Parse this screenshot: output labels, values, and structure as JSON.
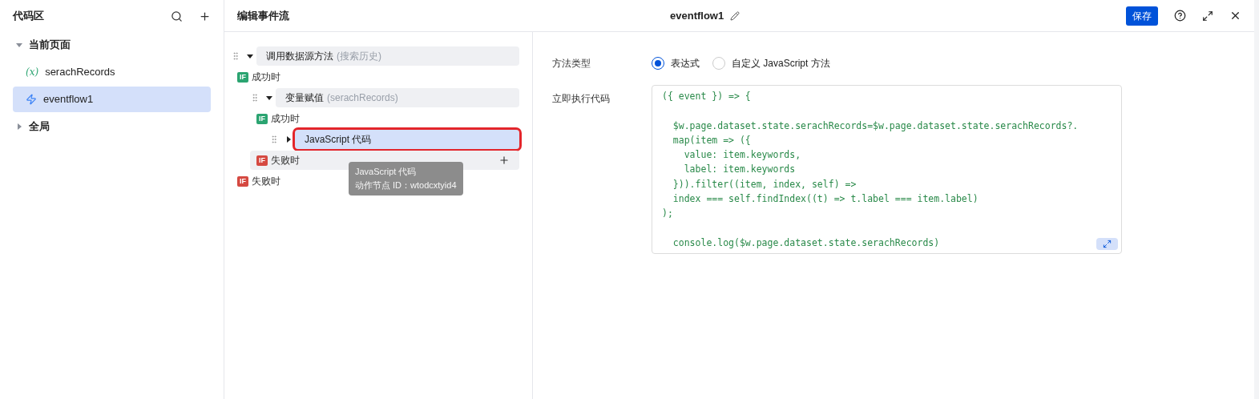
{
  "sidebar": {
    "title": "代码区",
    "groups": [
      {
        "label": "当前页面",
        "expanded": true,
        "children": [
          {
            "kind": "variable",
            "prefix": "(x)",
            "label": "serachRecords",
            "selected": false
          },
          {
            "kind": "flow",
            "label": "eventflow1",
            "selected": true
          }
        ]
      },
      {
        "label": "全局",
        "expanded": false
      }
    ]
  },
  "panel": {
    "title": "编辑事件流",
    "flow_name": "eventflow1",
    "save_label": "保存"
  },
  "tree": [
    {
      "kind": "action",
      "title": "调用数据源方法",
      "subtitle": "(搜索历史)",
      "expanded": true,
      "selected": false,
      "children": [
        {
          "kind": "branch",
          "badge": "IF",
          "color": "#2ba471",
          "label": "成功时",
          "children": [
            {
              "kind": "action",
              "title": "变量赋值",
              "subtitle": "(serachRecords)",
              "expanded": true,
              "selected": false,
              "children": [
                {
                  "kind": "branch",
                  "badge": "IF",
                  "color": "#2ba471",
                  "label": "成功时",
                  "children": [
                    {
                      "kind": "action",
                      "title": "JavaScript 代码",
                      "expanded": false,
                      "selected": true
                    }
                  ]
                },
                {
                  "kind": "branch",
                  "badge": "IF",
                  "color": "#d54941",
                  "label": "失败时",
                  "add": true
                }
              ]
            }
          ]
        },
        {
          "kind": "branch",
          "badge": "IF",
          "color": "#d54941",
          "label": "失败时"
        }
      ]
    }
  ],
  "tooltip": {
    "title": "JavaScript 代码",
    "detail": "动作节点 ID：wtodcxtyid4"
  },
  "form": {
    "method_label": "方法类型",
    "options": [
      {
        "label": "表达式",
        "selected": true
      },
      {
        "label": "自定义 JavaScript 方法",
        "selected": false
      }
    ],
    "code_label": "立即执行代码",
    "code": [
      {
        "text": "({ event }) => {",
        "blank_before": false
      },
      {
        "text": "  $w.page.dataset.state.serachRecords=$w.page.dataset.state.serachRecords?.",
        "blank_before": true
      },
      {
        "text": "  map(item => ({",
        "blank_before": false
      },
      {
        "text": "    value: item.keywords,",
        "blank_before": false
      },
      {
        "text": "    label: item.keywords",
        "blank_before": false
      },
      {
        "text": "  })).filter((item, index, self) =>",
        "blank_before": false
      },
      {
        "text": "  index === self.findIndex((t) => t.label === item.label)",
        "blank_before": false
      },
      {
        "text": ");",
        "blank_before": false
      },
      {
        "text": "  console.log($w.page.dataset.state.serachRecords)",
        "blank_before": true
      }
    ]
  }
}
